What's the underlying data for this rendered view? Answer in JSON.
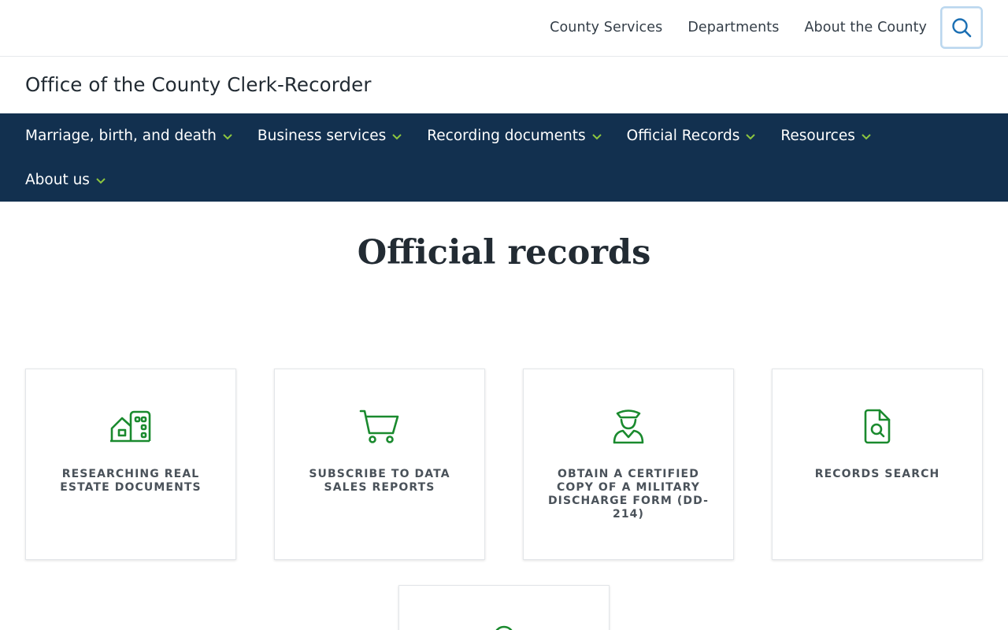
{
  "top_nav": {
    "links": [
      "County Services",
      "Departments",
      "About the County"
    ],
    "search_icon": "search-icon"
  },
  "site": {
    "title": "Office of the County Clerk-Recorder"
  },
  "main_nav": {
    "items": [
      "Marriage, birth, and death",
      "Business services",
      "Recording documents",
      "Official Records",
      "Resources",
      "About us"
    ],
    "chevron_color": "#8dc63f",
    "background": "#12304f"
  },
  "page": {
    "title": "Official records"
  },
  "cards": [
    {
      "label": "Researching real estate documents",
      "icon": "buildings-icon"
    },
    {
      "label": "Subscribe to data sales reports",
      "icon": "shopping-cart-icon"
    },
    {
      "label": "Obtain a certified copy of a military discharge form (DD-214)",
      "icon": "military-person-icon"
    },
    {
      "label": "Records search",
      "icon": "document-search-icon"
    },
    {
      "label": "",
      "icon": "location-pin-icon"
    }
  ],
  "colors": {
    "icon_green": "#1a8a2e",
    "accent_blue": "#1b6fb3"
  }
}
